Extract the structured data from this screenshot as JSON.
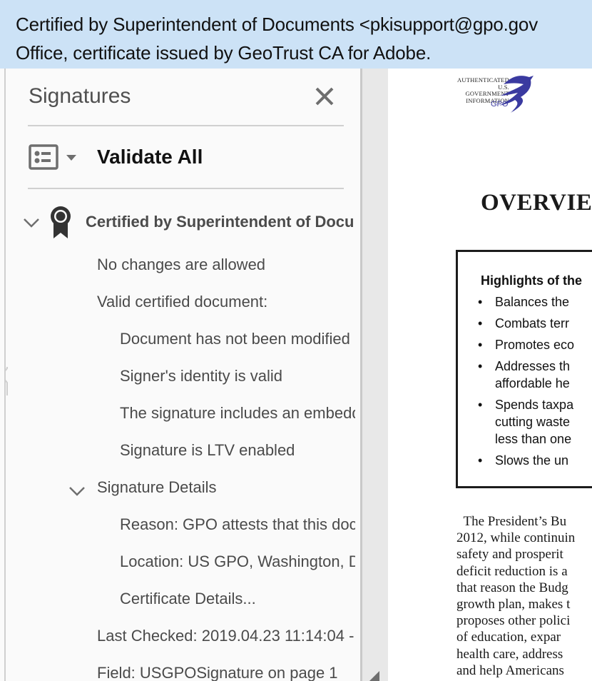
{
  "tooltip": {
    "lines": [
      "Certified by Superintendent of Documents <pkisupport@gpo.gov",
      "Office, certificate issued by GeoTrust CA for Adobe."
    ]
  },
  "signatures_panel": {
    "title": "Signatures",
    "close_icon": "close-icon",
    "view_icon": "list-view-icon",
    "validate_all_label": "Validate All",
    "tree": {
      "root_label": "Certified by Superintendent of Documents",
      "root_icon": "certification-seal-icon",
      "items": [
        {
          "label": "No changes are allowed",
          "level": 1
        },
        {
          "label": "Valid certified document:",
          "level": 1
        },
        {
          "label": "Document has not been modified",
          "level": 2
        },
        {
          "label": "Signer's identity is valid",
          "level": 2
        },
        {
          "label": "The signature includes an embedded timestamp",
          "level": 2
        },
        {
          "label": "Signature is LTV enabled",
          "level": 2
        }
      ],
      "details_group": {
        "label": "Signature Details",
        "items": [
          {
            "label": "Reason: GPO attests that this document"
          },
          {
            "label": "Location: US GPO, Washington, DC"
          },
          {
            "label": "Certificate Details..."
          }
        ]
      },
      "last_checked": "Last Checked: 2019.04.23 11:14:04 -",
      "field": "Field: USGPOSignature on page 1"
    }
  },
  "document": {
    "logo": {
      "lines": [
        "AUTHENTICATED",
        "U.S. GOVERNMENT",
        "INFORMATION"
      ],
      "org": "GPO"
    },
    "heading": "OVERVIEW",
    "highlights": {
      "title": "Highlights of the",
      "items": [
        [
          "Balances the"
        ],
        [
          "Combats terr"
        ],
        [
          "Promotes eco"
        ],
        [
          "Addresses th",
          "affordable he"
        ],
        [
          "Spends taxpa",
          "cutting waste",
          "less than one"
        ],
        [
          "Slows the un"
        ]
      ]
    },
    "body_lines": [
      "  The President’s Bu",
      "2012, while continuin",
      "safety and prosperit",
      "deficit reduction is a",
      "that reason the Budg",
      "growth plan, makes t",
      "proposes other polici",
      "of education, expar",
      "health care, address",
      "and help Americans"
    ]
  },
  "colors": {
    "tooltip_bg": "#cce2f6",
    "panel_bg": "#fafafa",
    "icon_gray": "#6e6e6e",
    "text_gray": "#4a4a4a",
    "logo_blue": "#3a3aa0"
  }
}
